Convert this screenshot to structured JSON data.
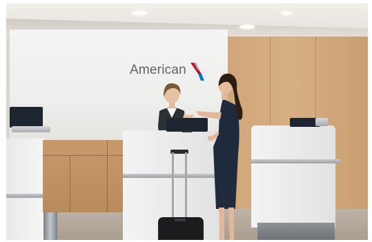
{
  "scene": {
    "wall_logo_text": "American",
    "logo_mark_colors": {
      "red": "#c8102e",
      "blue": "#0078d2",
      "silver": "#9da6ab"
    },
    "palette": {
      "wood": "#cfa77a",
      "counter_white": "#efefef",
      "agent_vest": "#2c3136",
      "traveler_dress": "#1f2a3d",
      "suitcase": "#1c1c1f"
    }
  }
}
